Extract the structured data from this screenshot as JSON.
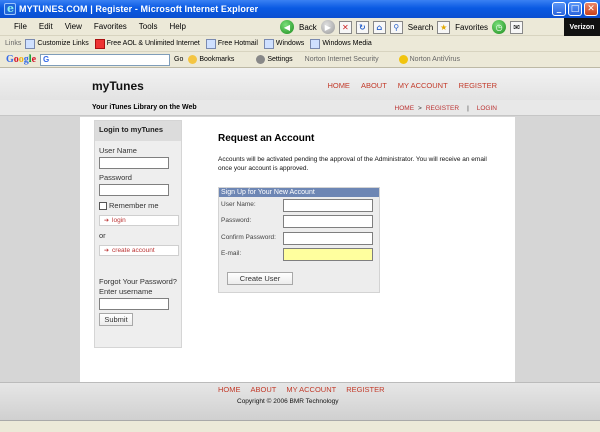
{
  "window": {
    "title": "MYTUNES.COM | Register - Microsoft Internet Explorer"
  },
  "menu": [
    "File",
    "Edit",
    "View",
    "Favorites",
    "Tools",
    "Help"
  ],
  "toolbar": {
    "back_label": "Back",
    "search_label": "Search",
    "favorites_label": "Favorites",
    "brand_label": "Verizon"
  },
  "links_bar": {
    "label": "Links",
    "items": [
      "Customize Links",
      "Free AOL & Unlimited Internet",
      "Free Hotmail",
      "Windows",
      "Windows Media"
    ]
  },
  "google_bar": {
    "logo_chars": [
      "G",
      "o",
      "o",
      "g",
      "l",
      "e"
    ],
    "go_label": "Go",
    "bookmarks_label": "Bookmarks",
    "settings_label": "Settings",
    "norton_security": "Norton Internet Security",
    "norton_antivirus": "Norton AntiVirus"
  },
  "site": {
    "logo": "myTunes",
    "nav": [
      "HOME",
      "ABOUT",
      "MY ACCOUNT",
      "REGISTER"
    ],
    "tagline": "Your iTunes Library on the Web",
    "breadcrumb": {
      "home": "HOME",
      "sep": ">",
      "current": "REGISTER",
      "divider": "|",
      "login": "LOGIN"
    }
  },
  "login": {
    "title": "Login to myTunes",
    "username_label": "User Name",
    "password_label": "Password",
    "remember_label": "Remember me",
    "login_button": "login",
    "or": "or",
    "create_button": "create account",
    "forgot_label": "Forgot Your Password?",
    "enter_username": "Enter username",
    "submit_button": "Submit"
  },
  "register": {
    "title": "Request an Account",
    "description": "Accounts will be activated pending the approval of the Administrator.  You will receive an email once your account is approved.",
    "panel_title": "Sign Up for Your New Account",
    "fields": [
      "User Name:",
      "Password:",
      "Confirm Password:",
      "E-mail:"
    ],
    "create_button": "Create User"
  },
  "footer": {
    "nav": [
      "HOME",
      "ABOUT",
      "MY ACCOUNT",
      "REGISTER"
    ],
    "copyright": "Copyright © 2006 BMR Technology"
  }
}
